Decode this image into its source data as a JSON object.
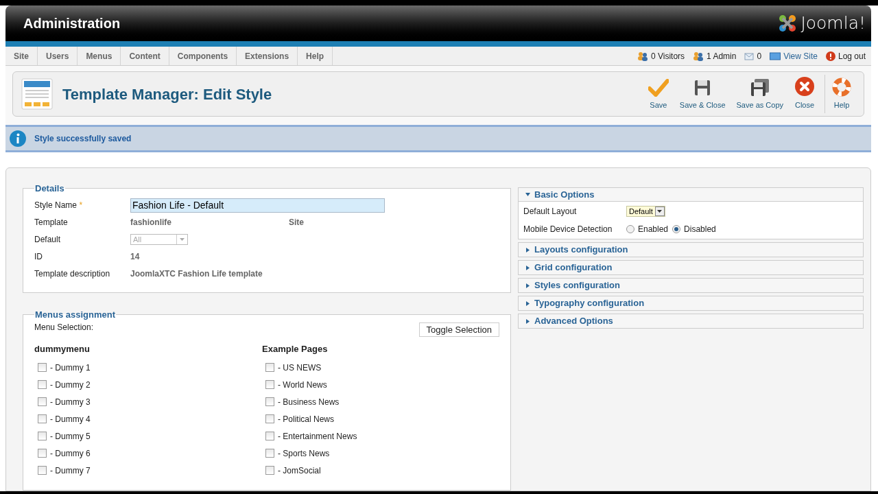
{
  "header": {
    "title": "Administration",
    "logo_text": "Joomla!"
  },
  "menu": [
    "Site",
    "Users",
    "Menus",
    "Content",
    "Components",
    "Extensions",
    "Help"
  ],
  "status": [
    {
      "kind": "visitors",
      "text": "0 Visitors"
    },
    {
      "kind": "admins",
      "text": "1 Admin"
    },
    {
      "kind": "messages",
      "text": "0"
    },
    {
      "kind": "view_site",
      "text": "View Site"
    },
    {
      "kind": "logout",
      "text": "Log out"
    }
  ],
  "page_title": "Template Manager: Edit Style",
  "toolbar": [
    {
      "kind": "save",
      "label": "Save"
    },
    {
      "kind": "save_close",
      "label": "Save & Close"
    },
    {
      "kind": "save_copy",
      "label": "Save as Copy"
    },
    {
      "kind": "close",
      "label": "Close"
    },
    {
      "kind": "help",
      "label": "Help"
    }
  ],
  "message": "Style successfully saved",
  "details": {
    "legend": "Details",
    "fields": [
      {
        "kind": "input",
        "label": "Style Name",
        "required_mark": "*",
        "value": "Fashion Life - Default"
      },
      {
        "kind": "text",
        "label": "Template",
        "value": "fashionlife",
        "extra": "Site"
      },
      {
        "kind": "select",
        "label": "Default",
        "value": "All",
        "disabled": true
      },
      {
        "kind": "text",
        "label": "ID",
        "value": "14"
      },
      {
        "kind": "text",
        "label": "Template description",
        "value": "JoomlaXTC Fashion Life template"
      }
    ]
  },
  "options": [
    {
      "title": "Basic Options",
      "expanded": true,
      "fields": [
        {
          "kind": "select",
          "label": "Default Layout",
          "value": "Default"
        },
        {
          "kind": "radio",
          "label": "Mobile Device Detection",
          "choices": [
            {
              "label": "Enabled",
              "selected": false
            },
            {
              "label": "Disabled",
              "selected": true
            }
          ]
        }
      ]
    },
    {
      "title": "Layouts configuration",
      "expanded": false
    },
    {
      "title": "Grid configuration",
      "expanded": false
    },
    {
      "title": "Styles configuration",
      "expanded": false
    },
    {
      "title": "Typography configuration",
      "expanded": false
    },
    {
      "title": "Advanced Options",
      "expanded": false
    }
  ],
  "menus_assignment": {
    "legend": "Menus assignment",
    "selection_label": "Menu Selection:",
    "toggle_button": "Toggle Selection",
    "menus": [
      {
        "title": "dummymenu",
        "items": [
          {
            "label": "- Dummy 1",
            "checked": false
          },
          {
            "label": "- Dummy 2",
            "checked": false
          },
          {
            "label": "- Dummy 3",
            "checked": false
          },
          {
            "label": "- Dummy 4",
            "checked": false
          },
          {
            "label": "- Dummy 5",
            "checked": false
          },
          {
            "label": "- Dummy 6",
            "checked": false
          },
          {
            "label": "- Dummy 7",
            "checked": false
          }
        ]
      },
      {
        "title": "Example Pages",
        "items": [
          {
            "label": "- US NEWS",
            "checked": false
          },
          {
            "label": "- World News",
            "checked": false
          },
          {
            "label": "- Business News",
            "checked": false
          },
          {
            "label": "- Political News",
            "checked": false
          },
          {
            "label": "- Entertainment News",
            "checked": false
          },
          {
            "label": "- Sports News",
            "checked": false
          },
          {
            "label": "- JomSocial",
            "checked": false
          }
        ]
      }
    ]
  }
}
